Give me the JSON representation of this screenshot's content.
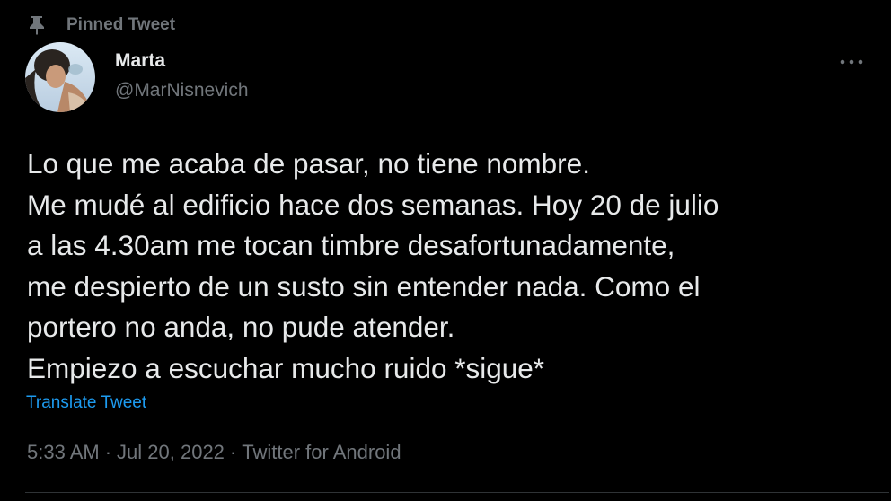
{
  "pinned": {
    "label": "Pinned Tweet",
    "icon": "pin-icon"
  },
  "author": {
    "name": "Marta",
    "handle": "@MarNisnevich",
    "avatar_icon": "avatar-photo"
  },
  "tweet": {
    "lines": [
      "Lo que me acaba de pasar, no tiene nombre.",
      "Me mudé al edificio hace dos semanas. Hoy 20 de julio",
      "a las 4.30am me tocan timbre desafortunadamente,",
      "me despierto de un susto sin entender nada. Como el",
      "portero no anda, no pude atender.",
      "Empiezo a escuchar mucho ruido *sigue*"
    ],
    "translate_label": "Translate Tweet"
  },
  "meta": {
    "time": "5:33 AM",
    "separator": "·",
    "date": "Jul 20, 2022",
    "source": "Twitter for Android"
  },
  "colors": {
    "background": "#000000",
    "text": "#e7e9ea",
    "secondary": "#71767b",
    "link": "#1d9bf0"
  },
  "more_icon": "more-horizontal-icon"
}
